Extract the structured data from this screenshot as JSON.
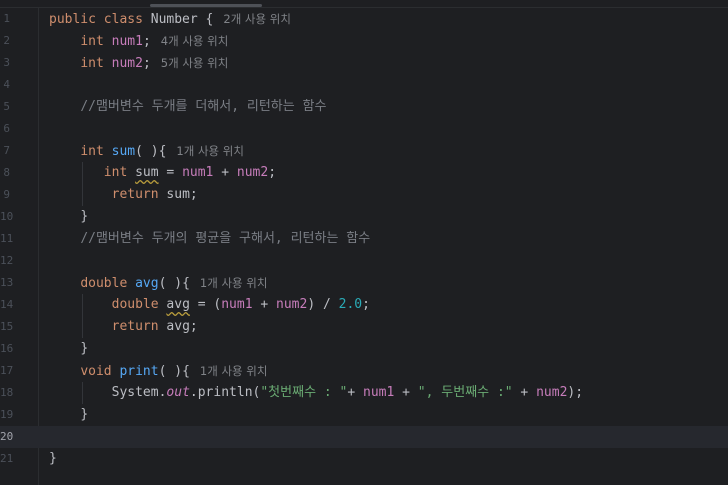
{
  "editor": {
    "lines": [
      {
        "n": "1",
        "tokens": [
          {
            "t": "public class ",
            "c": "kw"
          },
          {
            "t": "Number {",
            "c": "plain"
          }
        ],
        "hint": "2개 사용 위치"
      },
      {
        "n": "2",
        "tokens": [
          {
            "t": "    "
          },
          {
            "t": "int ",
            "c": "kw"
          },
          {
            "t": "num1",
            "c": "fld"
          },
          {
            "t": ";",
            "c": "plain"
          }
        ],
        "hint": "4개 사용 위치"
      },
      {
        "n": "3",
        "tokens": [
          {
            "t": "    "
          },
          {
            "t": "int ",
            "c": "kw"
          },
          {
            "t": "num2",
            "c": "fld"
          },
          {
            "t": ";",
            "c": "plain"
          }
        ],
        "hint": "5개 사용 위치"
      },
      {
        "n": "4",
        "tokens": []
      },
      {
        "n": "5",
        "tokens": [
          {
            "t": "    "
          },
          {
            "t": "//맴버변수 두개를 더해서, 리턴하는 함수",
            "c": "cmt"
          }
        ]
      },
      {
        "n": "6",
        "tokens": []
      },
      {
        "n": "7",
        "tokens": [
          {
            "t": "    "
          },
          {
            "t": "int ",
            "c": "kw"
          },
          {
            "t": "sum",
            "c": "fn"
          },
          {
            "t": "( ){",
            "c": "plain"
          }
        ],
        "hint": "1개 사용 위치"
      },
      {
        "n": "8",
        "tokens": [
          {
            "t": "       "
          },
          {
            "t": "int ",
            "c": "kw"
          },
          {
            "t": "sum",
            "c": "plain warn"
          },
          {
            "t": " = ",
            "c": "plain"
          },
          {
            "t": "num1",
            "c": "fld"
          },
          {
            "t": " + ",
            "c": "plain"
          },
          {
            "t": "num2",
            "c": "fld"
          },
          {
            "t": ";",
            "c": "plain"
          }
        ]
      },
      {
        "n": "9",
        "tokens": [
          {
            "t": "        "
          },
          {
            "t": "return ",
            "c": "kw"
          },
          {
            "t": "sum;",
            "c": "plain"
          }
        ]
      },
      {
        "n": "10",
        "tokens": [
          {
            "t": "    "
          },
          {
            "t": "}",
            "c": "plain"
          }
        ]
      },
      {
        "n": "11",
        "tokens": [
          {
            "t": "    "
          },
          {
            "t": "//맴버변수 두개의 평균을 구해서, 리턴하는 함수",
            "c": "cmt"
          }
        ]
      },
      {
        "n": "12",
        "tokens": []
      },
      {
        "n": "13",
        "tokens": [
          {
            "t": "    "
          },
          {
            "t": "double ",
            "c": "kw"
          },
          {
            "t": "avg",
            "c": "fn"
          },
          {
            "t": "( ){",
            "c": "plain"
          }
        ],
        "hint": "1개 사용 위치"
      },
      {
        "n": "14",
        "tokens": [
          {
            "t": "        "
          },
          {
            "t": "double ",
            "c": "kw"
          },
          {
            "t": "avg",
            "c": "plain warn"
          },
          {
            "t": " = (",
            "c": "plain"
          },
          {
            "t": "num1",
            "c": "fld"
          },
          {
            "t": " + ",
            "c": "plain"
          },
          {
            "t": "num2",
            "c": "fld"
          },
          {
            "t": ") / ",
            "c": "plain"
          },
          {
            "t": "2.0",
            "c": "num"
          },
          {
            "t": ";",
            "c": "plain"
          }
        ]
      },
      {
        "n": "15",
        "tokens": [
          {
            "t": "        "
          },
          {
            "t": "return ",
            "c": "kw"
          },
          {
            "t": "avg;",
            "c": "plain"
          }
        ]
      },
      {
        "n": "16",
        "tokens": [
          {
            "t": "    "
          },
          {
            "t": "}",
            "c": "plain"
          }
        ]
      },
      {
        "n": "17",
        "tokens": [
          {
            "t": "    "
          },
          {
            "t": "void ",
            "c": "kw"
          },
          {
            "t": "print",
            "c": "fn"
          },
          {
            "t": "( ){",
            "c": "plain"
          }
        ],
        "hint": "1개 사용 위치"
      },
      {
        "n": "18",
        "tokens": [
          {
            "t": "        "
          },
          {
            "t": "System.",
            "c": "plain"
          },
          {
            "t": "out",
            "c": "sf"
          },
          {
            "t": ".println(",
            "c": "plain"
          },
          {
            "t": "\"첫번째수 : \"",
            "c": "str"
          },
          {
            "t": "+ ",
            "c": "plain"
          },
          {
            "t": "num1",
            "c": "fld"
          },
          {
            "t": " + ",
            "c": "plain"
          },
          {
            "t": "\", 두번째수 :\"",
            "c": "str"
          },
          {
            "t": " + ",
            "c": "plain"
          },
          {
            "t": "num2",
            "c": "fld"
          },
          {
            "t": ");",
            "c": "plain"
          }
        ]
      },
      {
        "n": "19",
        "tokens": [
          {
            "t": "    "
          },
          {
            "t": "}",
            "c": "plain"
          }
        ]
      },
      {
        "n": "20",
        "tokens": [],
        "current": true
      },
      {
        "n": "21",
        "tokens": [
          {
            "t": "}",
            "c": "plain"
          }
        ]
      }
    ]
  }
}
